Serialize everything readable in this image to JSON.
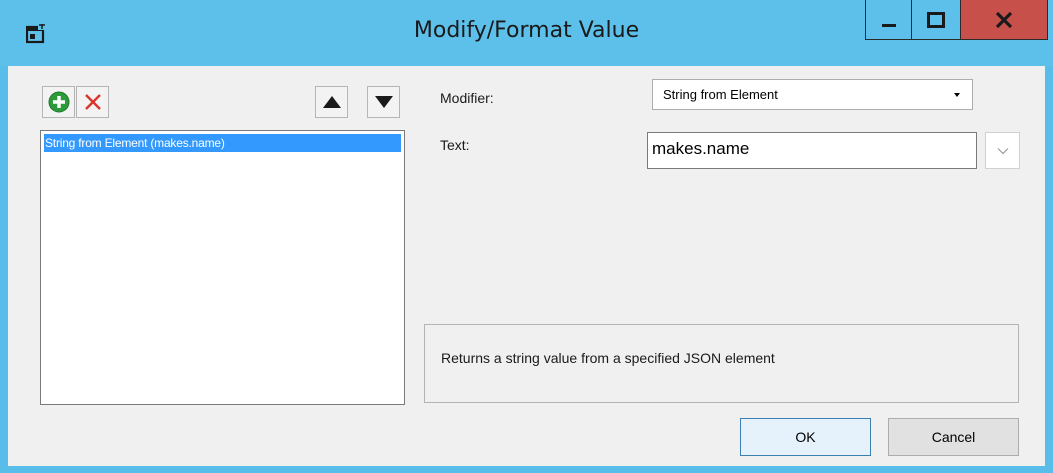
{
  "window": {
    "title": "Modify/Format Value",
    "icon": "window-icon",
    "controls": {
      "minimize": "minimize-icon",
      "maximize": "maximize-icon",
      "close": "close-icon"
    },
    "colors": {
      "titlebar": "#5cc0eb",
      "close": "#c7504b",
      "selection": "#3399ff"
    }
  },
  "toolbar": {
    "add": "add-icon",
    "remove": "remove-icon",
    "up": "move-up-icon",
    "down": "move-down-icon"
  },
  "modifiers_list": {
    "items": [
      {
        "label": "String from Element (makes.name)",
        "selected": true
      }
    ]
  },
  "form": {
    "modifier_label": "Modifier:",
    "modifier_value": "String from Element",
    "text_label": "Text:",
    "text_value": "makes.name"
  },
  "description": "Returns a string value from a specified JSON element",
  "buttons": {
    "ok": "OK",
    "cancel": "Cancel"
  }
}
